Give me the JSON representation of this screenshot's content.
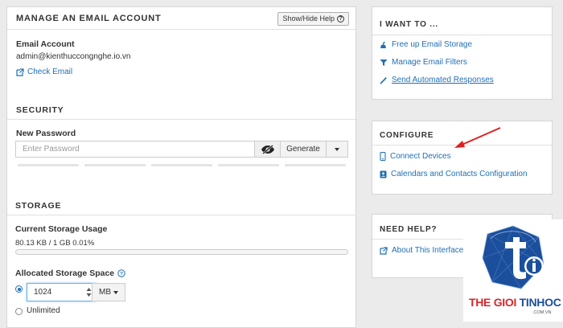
{
  "main": {
    "title": "MANAGE AN EMAIL ACCOUNT",
    "help_button": "Show/Hide Help",
    "email_account_label": "Email Account",
    "email_account_value": "admin@kienthuccongnghe.io.vn",
    "check_email_link": "Check Email",
    "security": {
      "title": "SECURITY",
      "new_password_label": "New Password",
      "password_placeholder": "Enter Password",
      "generate_button": "Generate"
    },
    "storage": {
      "title": "STORAGE",
      "current_usage_label": "Current Storage Usage",
      "current_usage_value": "80.13 KB / 1 GB 0.01%",
      "usage_fraction": 0.0001,
      "allocated_label": "Allocated Storage Space",
      "allocated_value": "1024",
      "unit": "MB",
      "unlimited_label": "Unlimited"
    }
  },
  "sidebar": {
    "i_want_to": {
      "title": "I WANT TO ...",
      "items": [
        {
          "label": "Free up Email Storage",
          "icon": "broom-icon"
        },
        {
          "label": "Manage Email Filters",
          "icon": "filter-icon"
        },
        {
          "label": " Send Automated Responses",
          "icon": "magic-wand-icon"
        }
      ]
    },
    "configure": {
      "title": "CONFIGURE",
      "items": [
        {
          "label": "Connect Devices",
          "icon": "mobile-icon"
        },
        {
          "label": "Calendars and Contacts Configuration",
          "icon": "contact-book-icon"
        }
      ]
    },
    "need_help": {
      "title": "NEED HELP?",
      "items": [
        {
          "label": "About This Interface",
          "icon": "external-link-icon"
        }
      ]
    }
  },
  "watermark": {
    "brand_text_1": "THE GIOI",
    "brand_text_2": "TINHOC",
    "domain_text": ".COM.VN"
  },
  "colors": {
    "link": "#1f6fb5",
    "annotation_arrow": "#e02020",
    "brand_red": "#d9262b",
    "brand_blue": "#1b4f9c"
  }
}
